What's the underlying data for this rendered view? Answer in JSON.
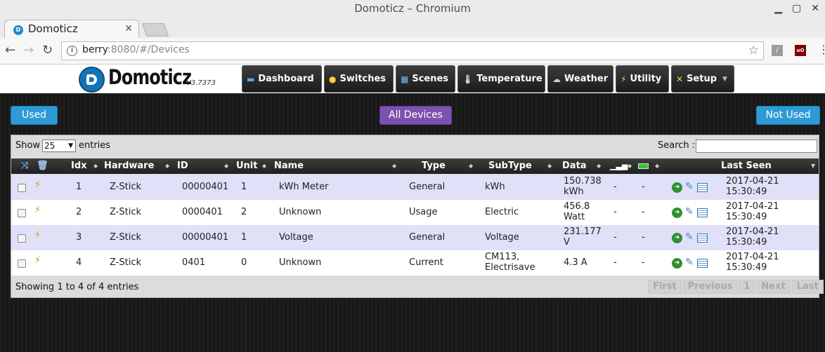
{
  "window": {
    "title": "Domoticz – Chromium"
  },
  "browser": {
    "tab_title": "Domoticz",
    "url_host": "berry",
    "url_rest": ":8080/#/Devices"
  },
  "header": {
    "logo_text": "Domoticz",
    "version": "V3.7373",
    "nav": [
      {
        "label": "Dashboard"
      },
      {
        "label": "Switches"
      },
      {
        "label": "Scenes"
      },
      {
        "label": "Temperature"
      },
      {
        "label": "Weather"
      },
      {
        "label": "Utility"
      },
      {
        "label": "Setup"
      }
    ]
  },
  "filters": {
    "used": "Used",
    "all": "All Devices",
    "not_used": "Not Used"
  },
  "table": {
    "length_label": "Show",
    "length_value": "25",
    "length_suffix": "entries",
    "search_label": "Search :",
    "columns": [
      "Idx",
      "Hardware",
      "ID",
      "Unit",
      "Name",
      "Type",
      "SubType",
      "Data",
      "Last Seen"
    ],
    "rows": [
      {
        "idx": "1",
        "hardware": "Z-Stick",
        "id": "00000401",
        "unit": "1",
        "name": "kWh Meter",
        "type": "General",
        "subtype": [
          "kWh",
          ""
        ],
        "data": [
          "150.738",
          "kWh"
        ],
        "signal": "-",
        "battery": "-",
        "last_seen": [
          "2017-04-21",
          "15:30:49"
        ]
      },
      {
        "idx": "2",
        "hardware": "Z-Stick",
        "id": "0000401",
        "unit": "2",
        "name": "Unknown",
        "type": "Usage",
        "subtype": [
          "Electric",
          ""
        ],
        "data": [
          "456.8",
          "Watt"
        ],
        "signal": "-",
        "battery": "-",
        "last_seen": [
          "2017-04-21",
          "15:30:49"
        ]
      },
      {
        "idx": "3",
        "hardware": "Z-Stick",
        "id": "00000401",
        "unit": "1",
        "name": "Voltage",
        "type": "General",
        "subtype": [
          "Voltage",
          ""
        ],
        "data": [
          "231.177",
          "V"
        ],
        "signal": "-",
        "battery": "-",
        "last_seen": [
          "2017-04-21",
          "15:30:49"
        ]
      },
      {
        "idx": "4",
        "hardware": "Z-Stick",
        "id": "0401",
        "unit": "0",
        "name": "Unknown",
        "type": "Current",
        "subtype": [
          "CM113,",
          "Electrisave"
        ],
        "data": [
          "4.3 A",
          ""
        ],
        "signal": "-",
        "battery": "-",
        "last_seen": [
          "2017-04-21",
          "15:30:49"
        ]
      }
    ],
    "info": "Showing 1 to 4 of 4 entries",
    "pager": {
      "first": "First",
      "previous": "Previous",
      "page": "1",
      "next": "Next",
      "last": "Last"
    }
  },
  "colors": {
    "used": "#2e9bd6",
    "all_devices": "#7c52b0",
    "row_odd": "#e0e0f8"
  }
}
